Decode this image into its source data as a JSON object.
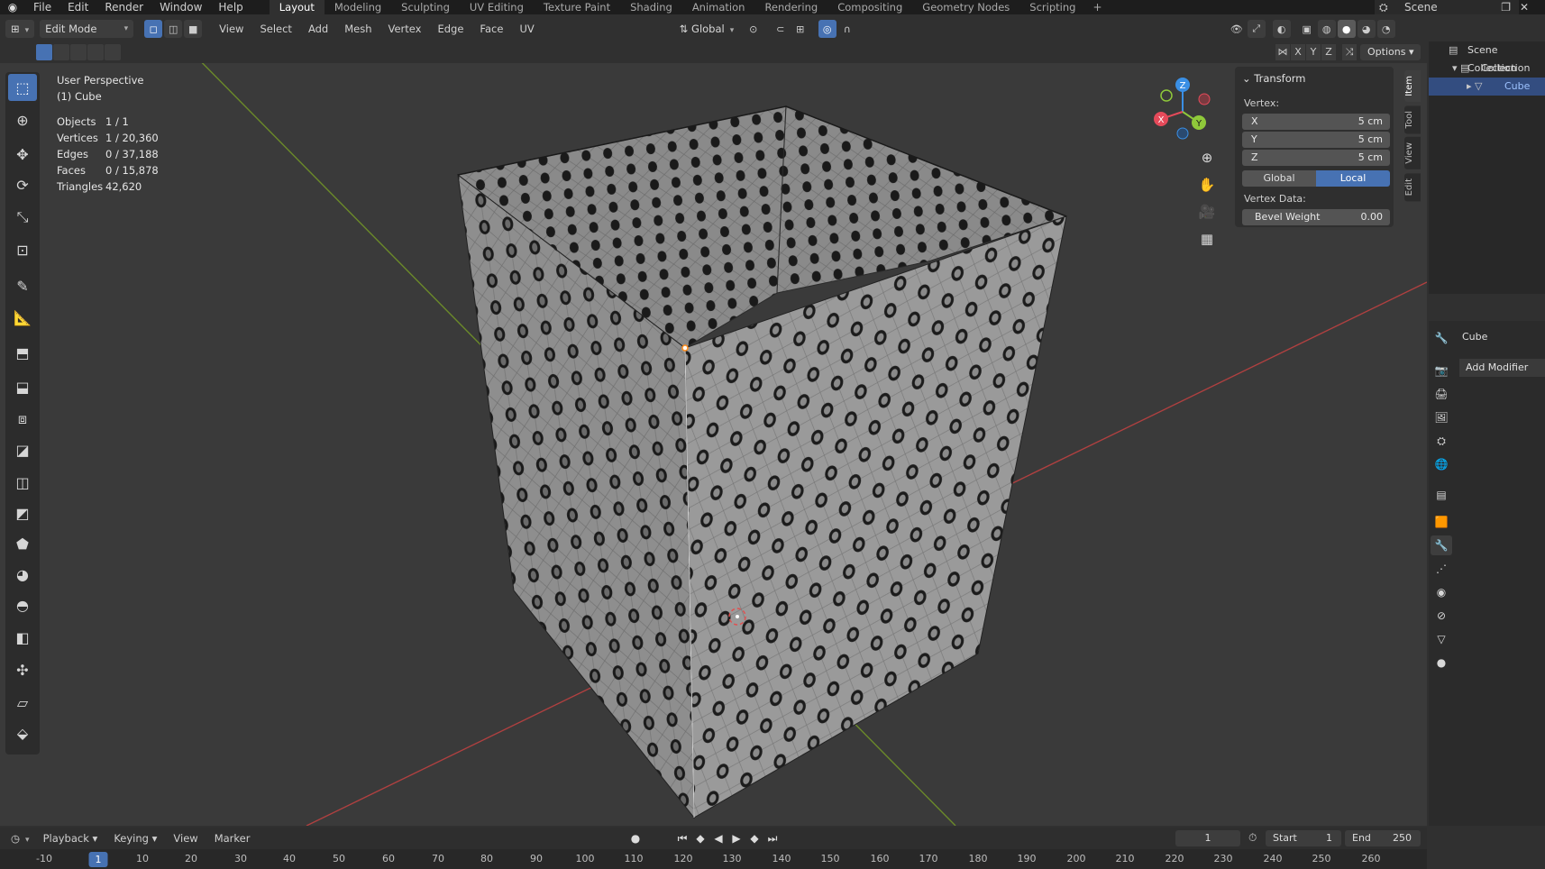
{
  "topbar": {
    "menus": [
      "File",
      "Edit",
      "Render",
      "Window",
      "Help"
    ],
    "workspaces": [
      "Layout",
      "Modeling",
      "Sculpting",
      "UV Editing",
      "Texture Paint",
      "Shading",
      "Animation",
      "Rendering",
      "Compositing",
      "Geometry Nodes",
      "Scripting"
    ],
    "active_workspace": "Layout",
    "scene": "Scene"
  },
  "viewport_header": {
    "mode": "Edit Mode",
    "menus": [
      "View",
      "Select",
      "Add",
      "Mesh",
      "Vertex",
      "Edge",
      "Face",
      "UV"
    ],
    "orientation": "Global",
    "options_label": "Options",
    "axes": [
      "X",
      "Y",
      "Z"
    ]
  },
  "overlay": {
    "view_name": "User Perspective",
    "object_name": "(1) Cube",
    "stats": [
      {
        "key": "Objects",
        "value": "1 / 1"
      },
      {
        "key": "Vertices",
        "value": "1 / 20,360"
      },
      {
        "key": "Edges",
        "value": "0 / 37,188"
      },
      {
        "key": "Faces",
        "value": "0 / 15,878"
      },
      {
        "key": "Triangles",
        "value": "42,620"
      }
    ]
  },
  "gizmo": {
    "x": "X",
    "y": "Y",
    "z": "Z",
    "colors": {
      "x": "#e54a5a",
      "y": "#8fc93a",
      "z": "#3a8fe5"
    }
  },
  "npanel": {
    "title": "Transform",
    "vertex_label": "Vertex:",
    "fields": [
      {
        "label": "X",
        "value": "5 cm"
      },
      {
        "label": "Y",
        "value": "5 cm"
      },
      {
        "label": "Z",
        "value": "5 cm"
      }
    ],
    "space_options": [
      "Global",
      "Local"
    ],
    "active_space": "Local",
    "vertex_data_label": "Vertex Data:",
    "bevel_label": "Bevel Weight",
    "bevel_value": "0.00",
    "tabs": [
      "Item",
      "Tool",
      "View",
      "Edit"
    ]
  },
  "outliner": {
    "root": "Scene Collection",
    "collection": "Collection",
    "object": "Cube"
  },
  "properties": {
    "object_name": "Cube",
    "add_modifier": "Add Modifier"
  },
  "timeline": {
    "menus": [
      "Playback",
      "Keying",
      "View",
      "Marker"
    ],
    "current_frame": "1",
    "start_label": "Start",
    "start_value": "1",
    "end_label": "End",
    "end_value": "250",
    "ruler": [
      "-10",
      "1",
      "10",
      "20",
      "30",
      "40",
      "50",
      "60",
      "70",
      "80",
      "90",
      "100",
      "110",
      "120",
      "130",
      "140",
      "150",
      "160",
      "170",
      "180",
      "190",
      "200",
      "210",
      "220",
      "230",
      "240",
      "250",
      "260"
    ]
  },
  "colors": {
    "accent": "#4772b3",
    "x_axis": "#b04040",
    "y_axis": "#6b8a2a",
    "mesh": "#8c8c8c"
  }
}
